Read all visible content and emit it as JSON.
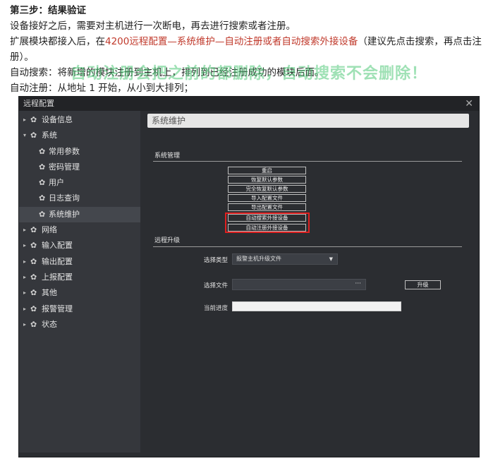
{
  "doc": {
    "step_title": "第三步：结果验证",
    "line1": "设备接好之后，需要对主机进行一次断电，再去进行搜索或者注册。",
    "line2_prefix": "扩展模块都接入后，在",
    "line2_red": "4200远程配置—系统维护—自动注册或者自动搜索外接设备",
    "line2_suffix": "（建议先点击搜索，再点击注",
    "line3": "册）。",
    "line4": "自动搜索：将新增的模块注册到主机上，排列到已经注册成功的模块后面。",
    "line5": "自动注册：从地址 1 开始，从小到大排列；"
  },
  "watermark": "自动注册会把之前的都删除，自动搜索不会删除！",
  "dialog": {
    "title": "远程配置",
    "close_glyph": "✕"
  },
  "sidebar": {
    "items": [
      {
        "label": "设备信息",
        "level": "top",
        "arrow": "▸"
      },
      {
        "label": "系统",
        "level": "top",
        "arrow": "▾"
      },
      {
        "label": "常用参数",
        "level": "sub"
      },
      {
        "label": "密码管理",
        "level": "sub"
      },
      {
        "label": "用户",
        "level": "sub"
      },
      {
        "label": "日志查询",
        "level": "sub"
      },
      {
        "label": "系统维护",
        "level": "sub",
        "active": true
      },
      {
        "label": "网络",
        "level": "top",
        "arrow": "▸"
      },
      {
        "label": "输入配置",
        "level": "top",
        "arrow": "▸"
      },
      {
        "label": "输出配置",
        "level": "top",
        "arrow": "▸"
      },
      {
        "label": "上报配置",
        "level": "top",
        "arrow": "▸"
      },
      {
        "label": "其他",
        "level": "top",
        "arrow": "▸"
      },
      {
        "label": "报警管理",
        "level": "top",
        "arrow": "▸"
      },
      {
        "label": "状态",
        "level": "top",
        "arrow": "▸"
      }
    ]
  },
  "content": {
    "section_title": "系统维护",
    "system_mgmt_label": "系统管理",
    "buttons": [
      {
        "label": "重启"
      },
      {
        "label": "恢复默认参数"
      },
      {
        "label": "完全恢复默认参数"
      },
      {
        "label": "导入配置文件"
      },
      {
        "label": "导出配置文件"
      },
      {
        "label": "自动搜索外接设备"
      },
      {
        "label": "自动注册外接设备"
      }
    ],
    "remote_upgrade_label": "远程升级",
    "select_type_label": "选择类型",
    "select_type_value": "报警主机升级文件",
    "select_file_label": "选择文件",
    "file_dots": "···",
    "upgrade_button": "升级",
    "progress_label": "当前进度",
    "progress_value": 0
  },
  "colors": {
    "accent_red": "#e02020",
    "doc_red": "#c0392b",
    "watermark": "#50c878"
  },
  "icons": {
    "nav_gear": "gear-icon",
    "arrow_right": "chevron-right-icon",
    "arrow_down": "chevron-down-icon",
    "dropdown": "caret-down-icon"
  }
}
